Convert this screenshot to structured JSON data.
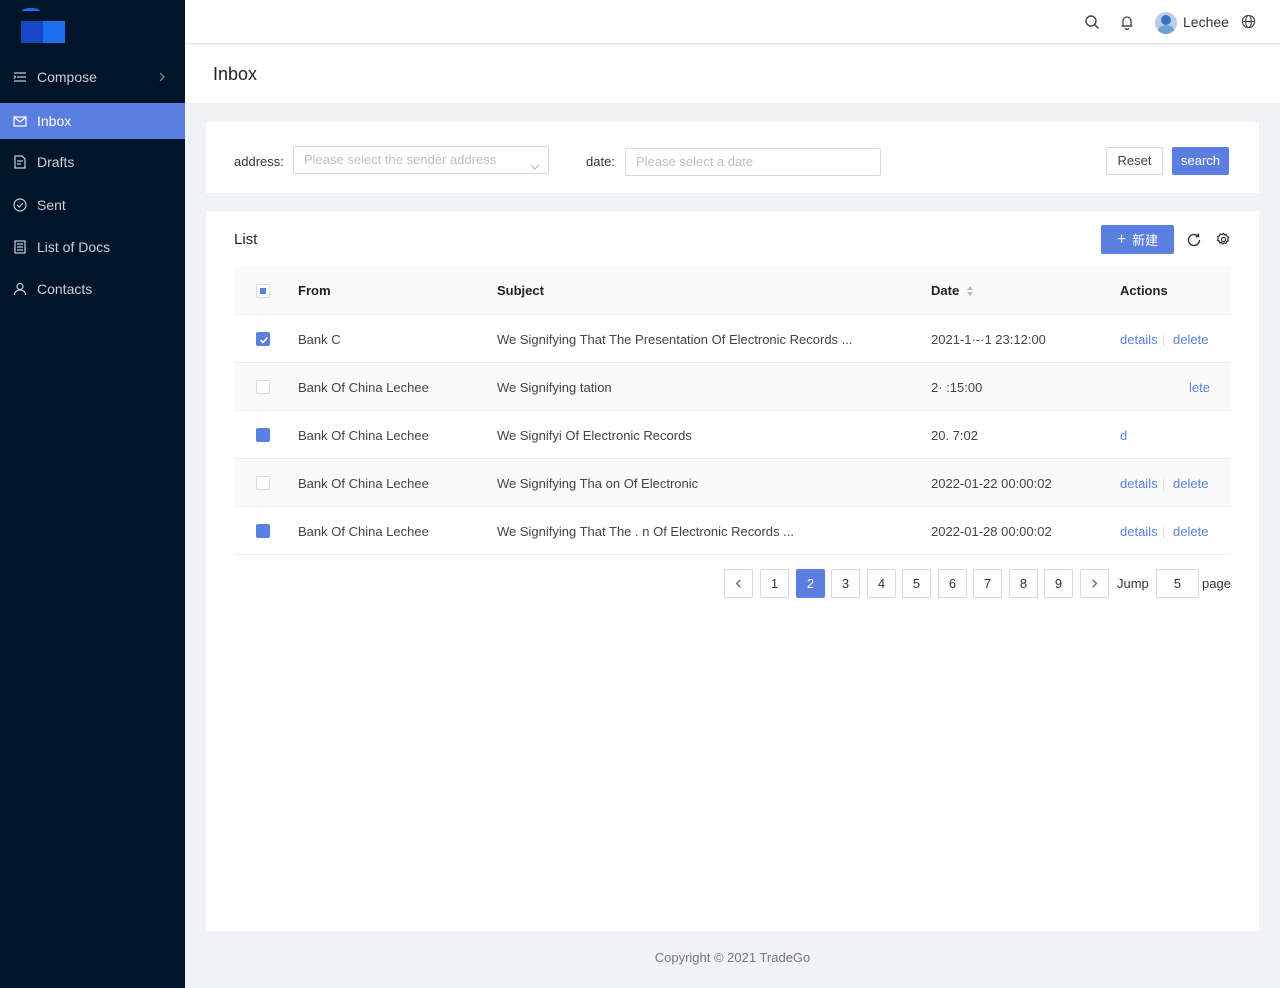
{
  "sidebar": {
    "items": [
      {
        "label": "Compose",
        "icon": "compose-icon"
      },
      {
        "label": "Inbox",
        "icon": "mail-icon"
      },
      {
        "label": "Drafts",
        "icon": "drafts-icon"
      },
      {
        "label": "Sent",
        "icon": "check-circle-icon"
      },
      {
        "label": "List of Docs",
        "icon": "docs-icon"
      },
      {
        "label": "Contacts",
        "icon": "user-icon"
      }
    ],
    "active": "Inbox"
  },
  "header": {
    "username": "Lechee"
  },
  "page": {
    "title": "Inbox"
  },
  "search": {
    "address_label": "address:",
    "address_placeholder": "Please select the sender address",
    "date_label": "date:",
    "date_placeholder": "Please select a date",
    "reset_label": "Reset",
    "search_label": "search"
  },
  "list": {
    "title": "List",
    "new_label": "新建",
    "columns": [
      "From",
      "Subject",
      "Date",
      "Actions"
    ],
    "rows": [
      {
        "from": "Bank C",
        "subject": "We Signifying That The Presentation Of Electronic Records  ...",
        "date": "2021-1·-·1  23:12:00",
        "checked": true,
        "details": "details",
        "delete": "delete"
      },
      {
        "from": "Bank Of China Lechee",
        "subject": "We Signifying                               tation",
        "date": "2·                    :15:00",
        "checked": false,
        "details": "",
        "delete": "lete"
      },
      {
        "from": "Bank Of China Lechee",
        "subject": "We Signifyi                      Of Electronic Records",
        "date": "20.                      7:02",
        "checked": true,
        "details": "d",
        "delete": ""
      },
      {
        "from": "Bank Of China Lechee",
        "subject": "We Signifying Tha                    on Of Electronic",
        "date": "2022-01-22  00:00:02",
        "checked": false,
        "details": "details",
        "delete": "delete"
      },
      {
        "from": "Bank Of China Lechee",
        "subject": "We Signifying That The .                 n Of Electronic Records  ...",
        "date": "2022-01-28  00:00:02",
        "checked": true,
        "details": "details",
        "delete": "delete"
      }
    ]
  },
  "pagination": {
    "pages": [
      "1",
      "2",
      "3",
      "4",
      "5",
      "6",
      "7",
      "8",
      "9"
    ],
    "current": "2",
    "jump_label": "Jump",
    "jump_value": "5",
    "page_label": "page"
  },
  "footer": {
    "copyright": "Copyright © 2021 TradeGo"
  },
  "colors": {
    "sidebar_bg": "#001529",
    "accent": "#5b7fe0"
  }
}
